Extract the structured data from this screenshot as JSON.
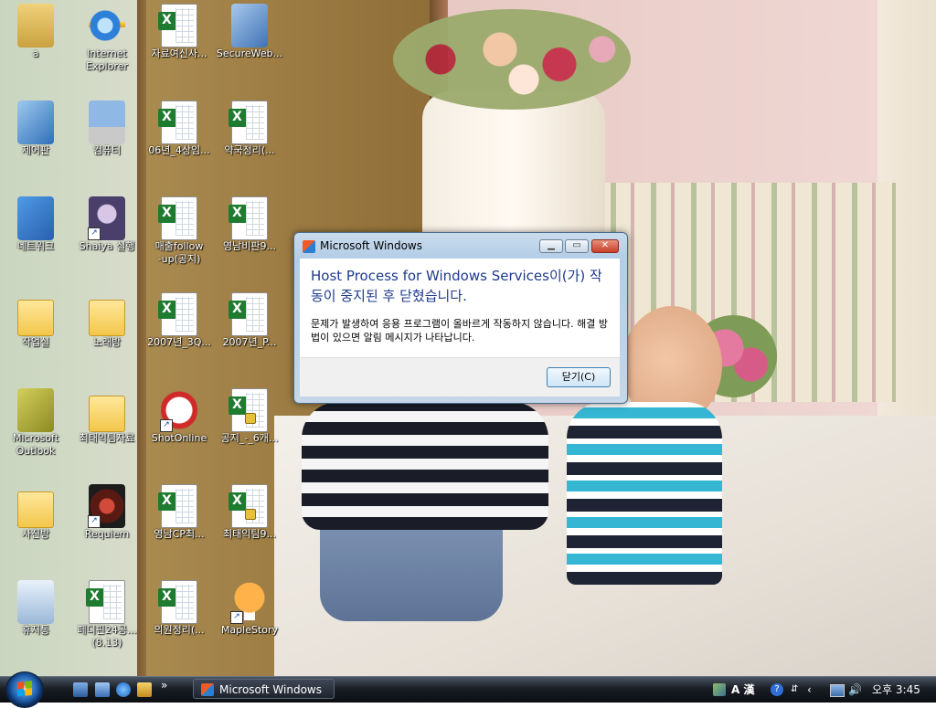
{
  "desktop": {
    "icons": [
      {
        "label": "a",
        "kind": "folder-doc"
      },
      {
        "label": "Internet\nExplorer",
        "kind": "ie"
      },
      {
        "label": "자료여신사...",
        "kind": "excel"
      },
      {
        "label": "SecureWeb...",
        "kind": "secure"
      },
      {
        "label": "제어판",
        "kind": "control-panel"
      },
      {
        "label": "컴퓨터",
        "kind": "computer"
      },
      {
        "label": "06년_4상임...",
        "kind": "excel"
      },
      {
        "label": "약국정리(...",
        "kind": "excel"
      },
      {
        "label": "네트워크",
        "kind": "network"
      },
      {
        "label": "Shaiya 실행",
        "kind": "game"
      },
      {
        "label": "매출follow\n-up(공지)",
        "kind": "excel"
      },
      {
        "label": "영남비판9...",
        "kind": "excel"
      },
      {
        "label": "작업실",
        "kind": "folder"
      },
      {
        "label": "노래방",
        "kind": "folder"
      },
      {
        "label": "2007년_3Q...",
        "kind": "excel"
      },
      {
        "label": "2007년_P...",
        "kind": "excel"
      },
      {
        "label": "Microsoft\nOutlook",
        "kind": "outlook"
      },
      {
        "label": "최태익팀자료",
        "kind": "folder"
      },
      {
        "label": "ShotOnline",
        "kind": "shotonline"
      },
      {
        "label": "공지_-_6개...",
        "kind": "excel-lock"
      },
      {
        "label": "사진방",
        "kind": "folder"
      },
      {
        "label": "Requiem",
        "kind": "requiem"
      },
      {
        "label": "영남CP최...",
        "kind": "excel"
      },
      {
        "label": "최태익팀9...",
        "kind": "excel-lock"
      },
      {
        "label": "휴지통",
        "kind": "recycle-bin"
      },
      {
        "label": "페디핀24공...\n(8.13)",
        "kind": "excel"
      },
      {
        "label": "의원정리(...",
        "kind": "excel"
      },
      {
        "label": "MapleStory",
        "kind": "maplestory"
      }
    ]
  },
  "dialog": {
    "title": "Microsoft Windows",
    "heading": "Host Process for Windows Services이(가) 작동이 중지된 후 닫혔습니다.",
    "message": "문제가 발생하여 응용 프로그램이 올바르게 작동하지 않습니다. 해결 방법이 있으면 알림 메시지가 나타납니다.",
    "close_button": "닫기(C)"
  },
  "taskbar": {
    "task_item": "Microsoft Windows",
    "ime": "A 漢",
    "clock": "오후 3:45",
    "overflow": "»"
  },
  "colors": {
    "dialog_heading": "#1e3a8c",
    "taskbar": "#0b0d11",
    "excel_green": "#1e7b2f"
  }
}
